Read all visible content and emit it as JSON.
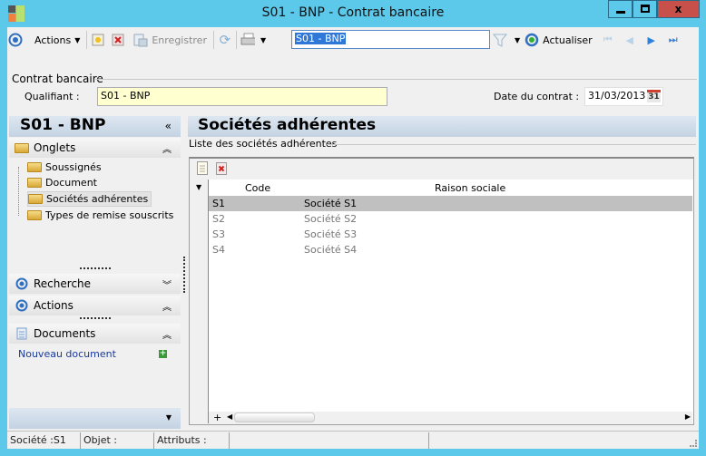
{
  "window": {
    "title": "S01 - BNP -  Contrat bancaire"
  },
  "toolbar": {
    "actions": "Actions",
    "save": "Enregistrer",
    "search_value": "S01 - BNP",
    "refresh": "Actualiser"
  },
  "form": {
    "group_label": "Contrat bancaire",
    "qualifiant_label": "Qualifiant :",
    "qualifiant_value": "S01 - BNP",
    "date_label": "Date du contrat :",
    "date_value": "31/03/2013",
    "calendar_day": "31"
  },
  "sidebar": {
    "title": "S01 - BNP",
    "onglets": "Onglets",
    "tree": [
      "Soussignés",
      "Document",
      "Sociétés adhérentes",
      "Types de remise souscrits"
    ],
    "recherche": "Recherche",
    "actions": "Actions",
    "documents": "Documents",
    "new_document": "Nouveau document"
  },
  "main": {
    "title": "Sociétés adhérentes",
    "group_label": "Liste des sociétés adhérentes",
    "columns": [
      "Code",
      "Raison sociale"
    ],
    "rows": [
      {
        "code": "S1",
        "name": "Société S1"
      },
      {
        "code": "S2",
        "name": "Société S2"
      },
      {
        "code": "S3",
        "name": "Société S3"
      },
      {
        "code": "S4",
        "name": "Société S4"
      }
    ]
  },
  "statusbar": {
    "societe": "Société :S1",
    "objet": "Objet :",
    "attributs": "Attributs :"
  }
}
